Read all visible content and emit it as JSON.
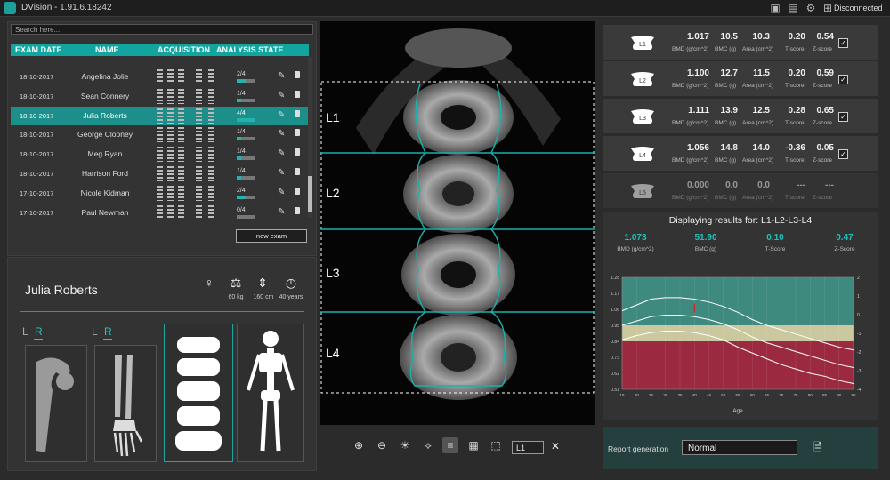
{
  "app": {
    "title": "DVision - 1.91.6.18242",
    "connection": "Disconnected"
  },
  "search": {
    "placeholder": "Search here..."
  },
  "table": {
    "headers": [
      "EXAM DATE",
      "NAME",
      "ACQUISITION",
      "ANALYSIS STATE"
    ],
    "rows": [
      {
        "date": "18-10-2017",
        "name": "Angelina Jolie",
        "state": "2/4",
        "progress": 0.5,
        "selected": false
      },
      {
        "date": "18-10-2017",
        "name": "Sean Connery",
        "state": "1/4",
        "progress": 0.25,
        "selected": false
      },
      {
        "date": "18-10-2017",
        "name": "Julia Roberts",
        "state": "4/4",
        "progress": 1.0,
        "selected": true
      },
      {
        "date": "18-10-2017",
        "name": "George Clooney",
        "state": "1/4",
        "progress": 0.25,
        "selected": false
      },
      {
        "date": "18-10-2017",
        "name": "Meg Ryan",
        "state": "1/4",
        "progress": 0.25,
        "selected": false
      },
      {
        "date": "18-10-2017",
        "name": "Harrison Ford",
        "state": "1/4",
        "progress": 0.25,
        "selected": false
      },
      {
        "date": "17-10-2017",
        "name": "Nicole Kidman",
        "state": "2/4",
        "progress": 0.5,
        "selected": false
      },
      {
        "date": "17-10-2017",
        "name": "Paul Newman",
        "state": "0/4",
        "progress": 0.0,
        "selected": false
      }
    ],
    "new_exam": "new exam"
  },
  "patient": {
    "name": "Julia Roberts",
    "weight": "60 kg",
    "height": "160 cm",
    "age": "40 years",
    "hip_side": {
      "l": "L",
      "r": "R"
    },
    "arm_side": {
      "l": "L",
      "r": "R"
    }
  },
  "scan": {
    "levels": [
      "L1",
      "L2",
      "L3",
      "L4"
    ],
    "selected_level": "L1"
  },
  "vertebrae": [
    {
      "label": "L1",
      "bmd": "1.017",
      "bmc": "10.5",
      "area": "10.3",
      "t": "0.20",
      "z": "0.54",
      "checked": true
    },
    {
      "label": "L2",
      "bmd": "1.100",
      "bmc": "12.7",
      "area": "11.5",
      "t": "0.20",
      "z": "0.59",
      "checked": true
    },
    {
      "label": "L3",
      "bmd": "1.111",
      "bmc": "13.9",
      "area": "12.5",
      "t": "0.28",
      "z": "0.65",
      "checked": true
    },
    {
      "label": "L4",
      "bmd": "1.056",
      "bmc": "14.8",
      "area": "14.0",
      "t": "-0.36",
      "z": "0.05",
      "checked": true
    },
    {
      "label": "L5",
      "bmd": "0.000",
      "bmc": "0.0",
      "area": "0.0",
      "t": "---",
      "z": "---",
      "checked": false
    }
  ],
  "units": {
    "bmd": "BMD (g/cm^2)",
    "bmc": "BMC (g)",
    "area": "Area (cm^2)",
    "t": "T-score",
    "z": "Z-score"
  },
  "results": {
    "title": "Displaying results for: L1-L2-L3-L4",
    "bmd": "1.073",
    "bmc": "51.90",
    "tscore": "0.10",
    "zscore": "0.47",
    "bmd_label": "BMD (g/cm^2)",
    "bmc_label": "BMC (g)",
    "t_label": "T-Score",
    "z_label": "Z-Score"
  },
  "chart_data": {
    "type": "line",
    "xlabel": "Age",
    "x": [
      15,
      20,
      25,
      30,
      35,
      40,
      45,
      50,
      55,
      60,
      65,
      70,
      75,
      80,
      85,
      90,
      95
    ],
    "xlim": [
      15,
      95
    ],
    "ylim": [
      0.51,
      1.28
    ],
    "yticks_left": [
      0.51,
      0.62,
      0.73,
      0.84,
      0.95,
      1.06,
      1.17,
      1.28
    ],
    "yticks_right": [
      -4,
      -3,
      -2,
      -1,
      0,
      1,
      2
    ],
    "bands": [
      {
        "name": "normal",
        "from": 0.95,
        "to": 1.28,
        "color": "#3f8a7e"
      },
      {
        "name": "osteopenia",
        "from": 0.84,
        "to": 0.95,
        "color": "#cbc79e"
      },
      {
        "name": "osteoporosis",
        "from": 0.51,
        "to": 0.84,
        "color": "#9b2a41"
      }
    ],
    "series": [
      {
        "values": [
          1.05,
          1.09,
          1.13,
          1.14,
          1.14,
          1.13,
          1.11,
          1.08,
          1.04,
          0.99,
          0.95,
          0.92,
          0.89,
          0.86,
          0.83,
          0.8,
          0.78
        ]
      },
      {
        "values": [
          0.95,
          0.98,
          1.01,
          1.02,
          1.02,
          1.01,
          0.99,
          0.96,
          0.92,
          0.87,
          0.83,
          0.8,
          0.77,
          0.74,
          0.71,
          0.68,
          0.66
        ]
      },
      {
        "values": [
          0.85,
          0.88,
          0.9,
          0.91,
          0.91,
          0.9,
          0.88,
          0.85,
          0.8,
          0.76,
          0.72,
          0.68,
          0.65,
          0.62,
          0.6,
          0.57,
          0.55
        ]
      }
    ],
    "marker": {
      "x": 40,
      "y": 1.07,
      "color": "#e02020"
    }
  },
  "report": {
    "label": "Report generation",
    "value": "Normal"
  },
  "colors": {
    "accent": "#12a5a0",
    "selected_row": "#1c8f8a"
  }
}
